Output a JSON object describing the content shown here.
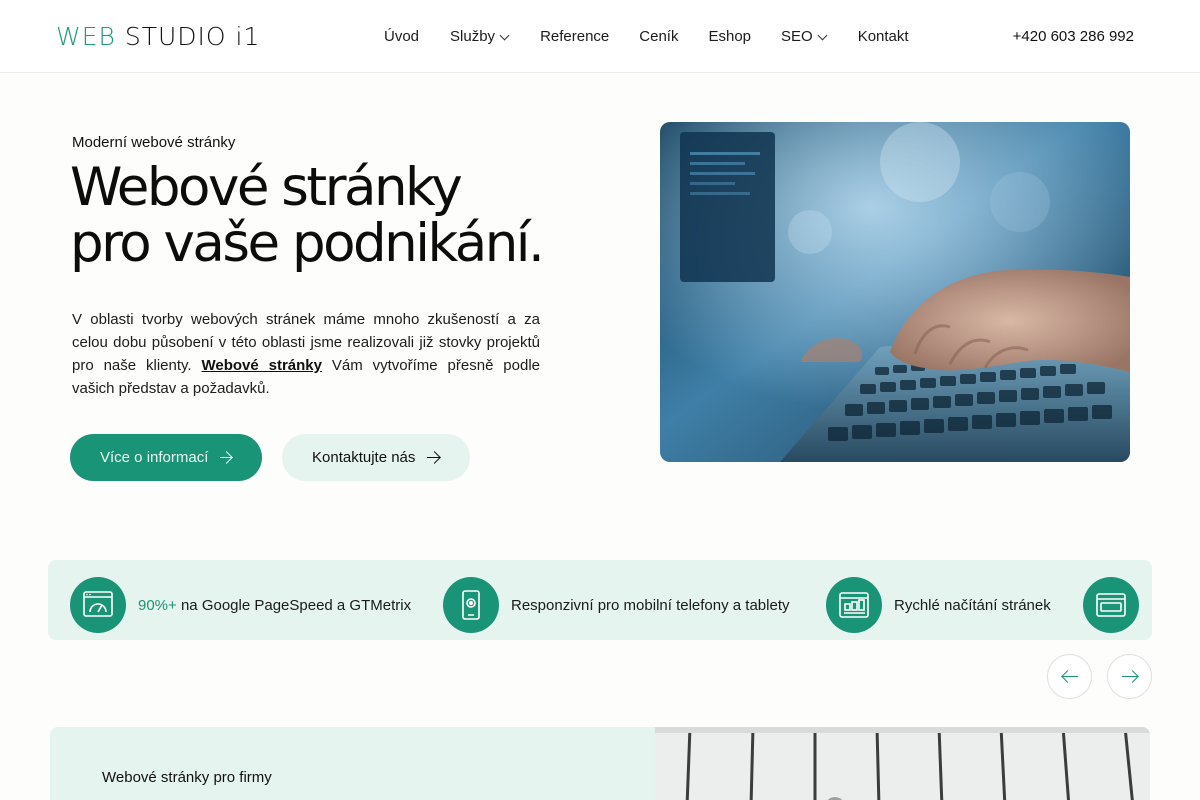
{
  "header": {
    "logo_part1": "WEB",
    "logo_part2": " STUDIO i1",
    "nav": [
      {
        "label": "Úvod",
        "dropdown": false
      },
      {
        "label": "Služby",
        "dropdown": true
      },
      {
        "label": "Reference",
        "dropdown": false
      },
      {
        "label": "Ceník",
        "dropdown": false
      },
      {
        "label": "Eshop",
        "dropdown": false
      },
      {
        "label": "SEO",
        "dropdown": true
      },
      {
        "label": "Kontakt",
        "dropdown": false
      }
    ],
    "phone": "+420 603 286 992"
  },
  "hero": {
    "eyebrow": "Moderní webové stránky",
    "title_line1": "Webové stránky",
    "title_line2": "pro vaše podnikání.",
    "text_before": "V oblasti tvorby webových stránek máme mnoho zkušeností a za celou dobu působení v této oblasti jsme realizovali již stovky projektů pro naše klienty. ",
    "text_link": "Webové stránky",
    "text_after": " Vám vytvoříme přesně podle vašich představ a požadavků.",
    "btn_primary": "Více o informací",
    "btn_secondary": "Kontaktujte nás"
  },
  "features": [
    {
      "icon": "speedometer-icon",
      "accent": "90%+",
      "text": " na Google PageSpeed a GTMetrix"
    },
    {
      "icon": "mobile-settings-icon",
      "accent": "",
      "text": "Responzivní pro mobilní telefony a tablety"
    },
    {
      "icon": "speed-chart-icon",
      "accent": "",
      "text": "Rychlé načítání stránek"
    },
    {
      "icon": "html-code-icon",
      "accent": "",
      "text": ""
    }
  ],
  "bottom": {
    "label": "Webové stránky pro firmy"
  },
  "colors": {
    "brand": "#1a9476",
    "brand_light": "#e6f4ef"
  }
}
